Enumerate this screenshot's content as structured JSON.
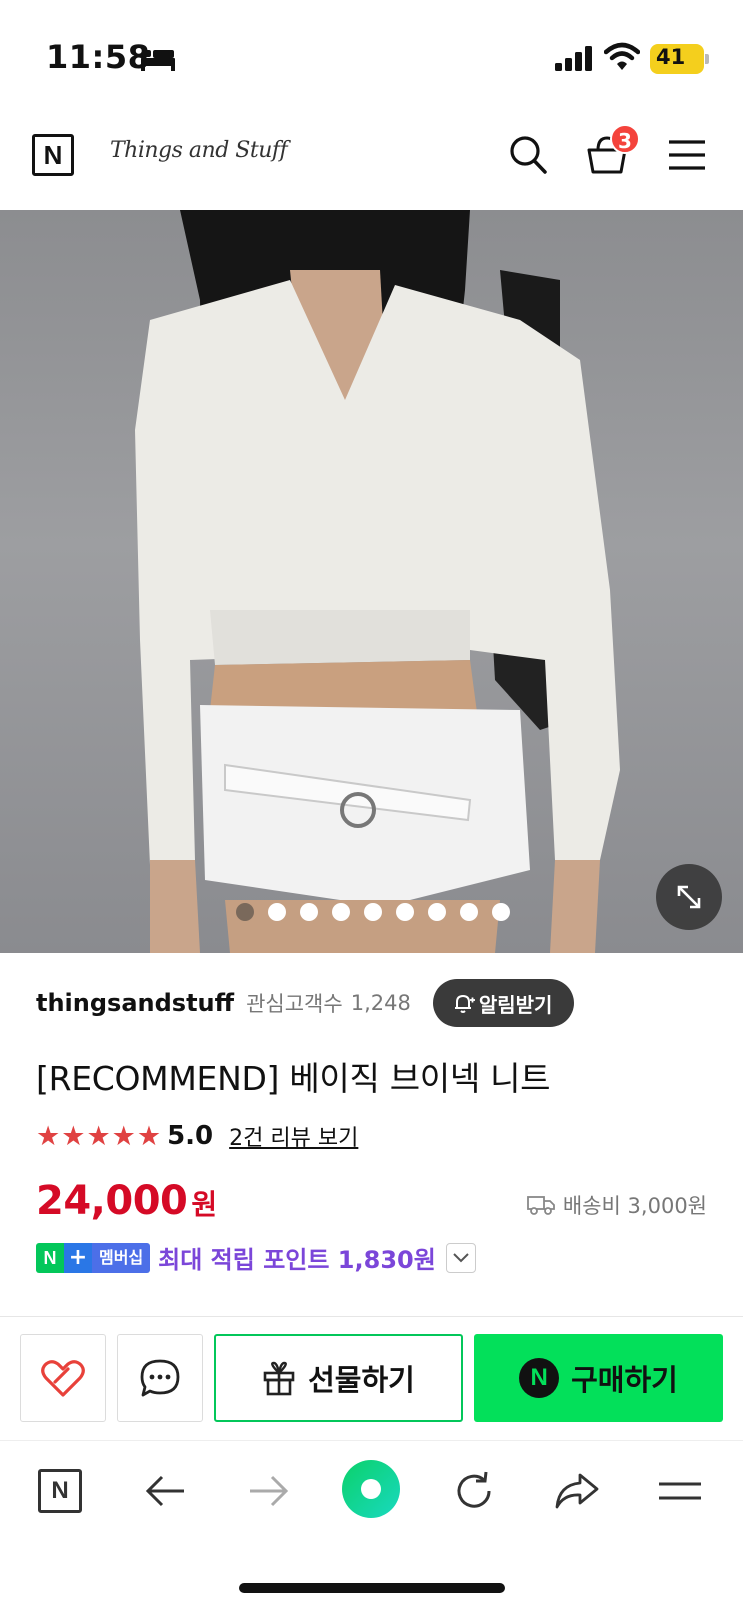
{
  "status_bar": {
    "time": "11:58",
    "battery": "41"
  },
  "header": {
    "logo_text": "N",
    "store_name": "Things and Stuff",
    "cart_count": "3"
  },
  "gallery": {
    "image_count": 9,
    "active_index": 0
  },
  "seller": {
    "name": "thingsandstuff",
    "follower_label": "관심고객수",
    "follower_count": "1,248",
    "alarm_label": "알림받기"
  },
  "product": {
    "title": "[RECOMMEND] 베이직 브이넥 니트",
    "rating_stars": 5,
    "rating": "5.0",
    "review_link": "2건 리뷰 보기",
    "price": "24,000",
    "price_unit": "원",
    "shipping": "배송비 3,000원",
    "membership_badge": "멤버십",
    "points_text": "최대 적립 포인트 1,830원"
  },
  "actions": {
    "gift_label": "선물하기",
    "buy_label": "구매하기",
    "buy_logo": "N"
  },
  "browser_bar": {
    "home_logo": "N"
  },
  "colors": {
    "price": "#d50a26",
    "naver_green": "#03c75a",
    "buy_green": "#03e05a",
    "points_purple": "#7b46d9",
    "star_red": "#e04242",
    "cart_badge": "#f4433c"
  }
}
